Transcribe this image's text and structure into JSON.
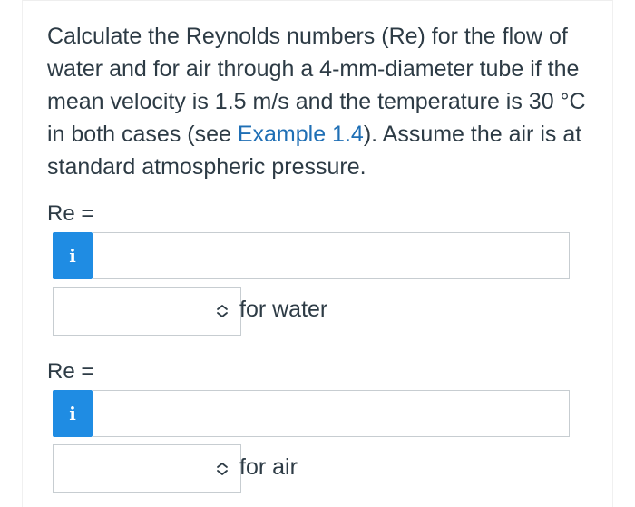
{
  "question": {
    "text_before_link": "Calculate the Reynolds numbers (Re) for the flow of water and for air through a 4-mm-diameter tube if the mean velocity is 1.5 m/s and the temperature is 30 °C in both cases (see ",
    "link_text": "Example 1.4",
    "text_after_link": "). Assume the air is at standard atmospheric pressure."
  },
  "answers": [
    {
      "label": "Re =",
      "info_icon": "i",
      "input_value": "",
      "select_value": "",
      "select_icon": "up-down-chevron",
      "suffix": "for water"
    },
    {
      "label": "Re =",
      "info_icon": "i",
      "input_value": "",
      "select_value": "",
      "select_icon": "up-down-chevron",
      "suffix": "for air"
    }
  ],
  "colors": {
    "info_button": "#1f8ce3",
    "link": "#1f6fb5",
    "text": "#2d3b45",
    "border": "#c7cdd1"
  }
}
